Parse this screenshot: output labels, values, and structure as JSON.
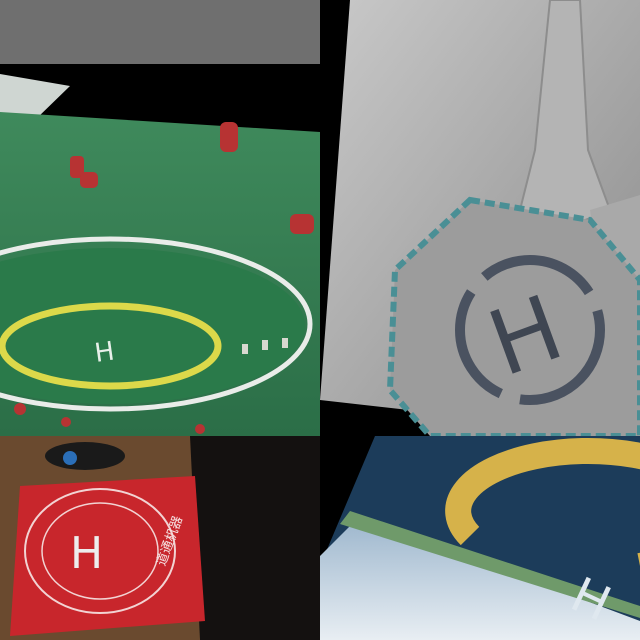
{
  "collage": {
    "panels": [
      {
        "id": "green-3d-helipad",
        "h_letter": "H",
        "ring_color": "#d8d64a",
        "deck_color": "#2f7a4f"
      },
      {
        "id": "stone-hexagon-helipad",
        "h_letter": "H",
        "deck_color": "#9a9a9a"
      },
      {
        "id": "red-mat-helipad",
        "h_letter": "H",
        "mat_color": "#c8262c",
        "mat_text": "道通机器"
      },
      {
        "id": "rooftop-yellow-ring-helipad",
        "h_letter": "H",
        "ring_color": "#d9b54a"
      }
    ]
  },
  "colors": {
    "background": "#000000",
    "top_gray_bar": "#6f6f6f"
  }
}
